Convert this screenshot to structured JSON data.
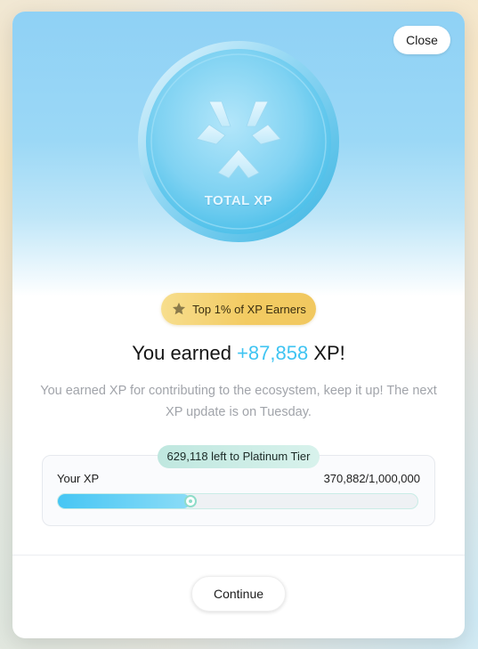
{
  "modal": {
    "close_label": "Close",
    "coin_label": "TOTAL XP",
    "badge_text": "Top 1% of XP Earners",
    "title_prefix": "You earned ",
    "title_amount": "+87,858",
    "title_suffix": " XP!",
    "subtitle": "You earned XP for contributing to the ecosystem, keep it up! The next XP update is on Tuesday.",
    "tier_pill": "629,118 left to Platinum Tier",
    "xp_label": "Your XP",
    "xp_value": "370,882/1,000,000",
    "xp_progress_fraction": 0.37,
    "continue_label": "Continue"
  },
  "colors": {
    "accent": "#3fc4f2",
    "badge_gold": "#f3cb62",
    "hero_blue": "#8fd1f5"
  },
  "icons": {
    "coin_logo": "total-xp-logo-icon",
    "badge_icon": "star-icon",
    "progress_thumb": "progress-thumb-icon"
  }
}
